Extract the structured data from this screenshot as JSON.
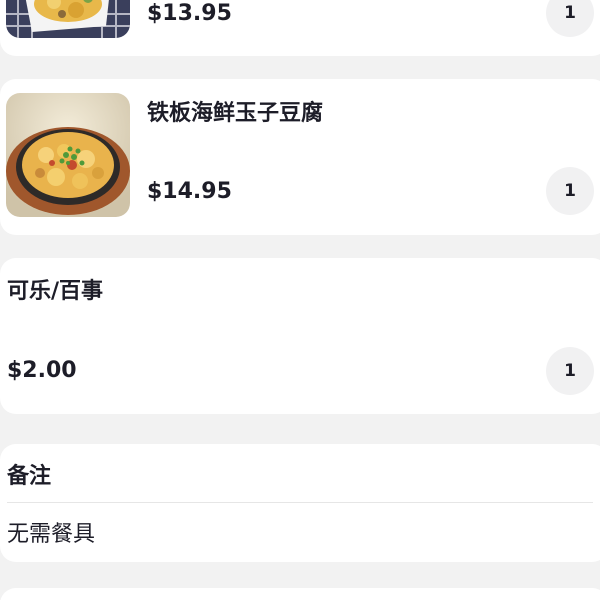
{
  "order_items": [
    {
      "name": "",
      "price": "$13.95",
      "quantity": "1"
    },
    {
      "name": "铁板海鲜玉子豆腐",
      "price": "$14.95",
      "quantity": "1"
    },
    {
      "name": "可乐/百事",
      "price": "$2.00",
      "quantity": "1"
    }
  ],
  "notes": {
    "title": "备注",
    "value": "无需餐具"
  },
  "colors": {
    "background": "#f2f2f2",
    "card": "#ffffff",
    "text": "#1d1d28",
    "quantity_badge": "#f1f1f2"
  }
}
